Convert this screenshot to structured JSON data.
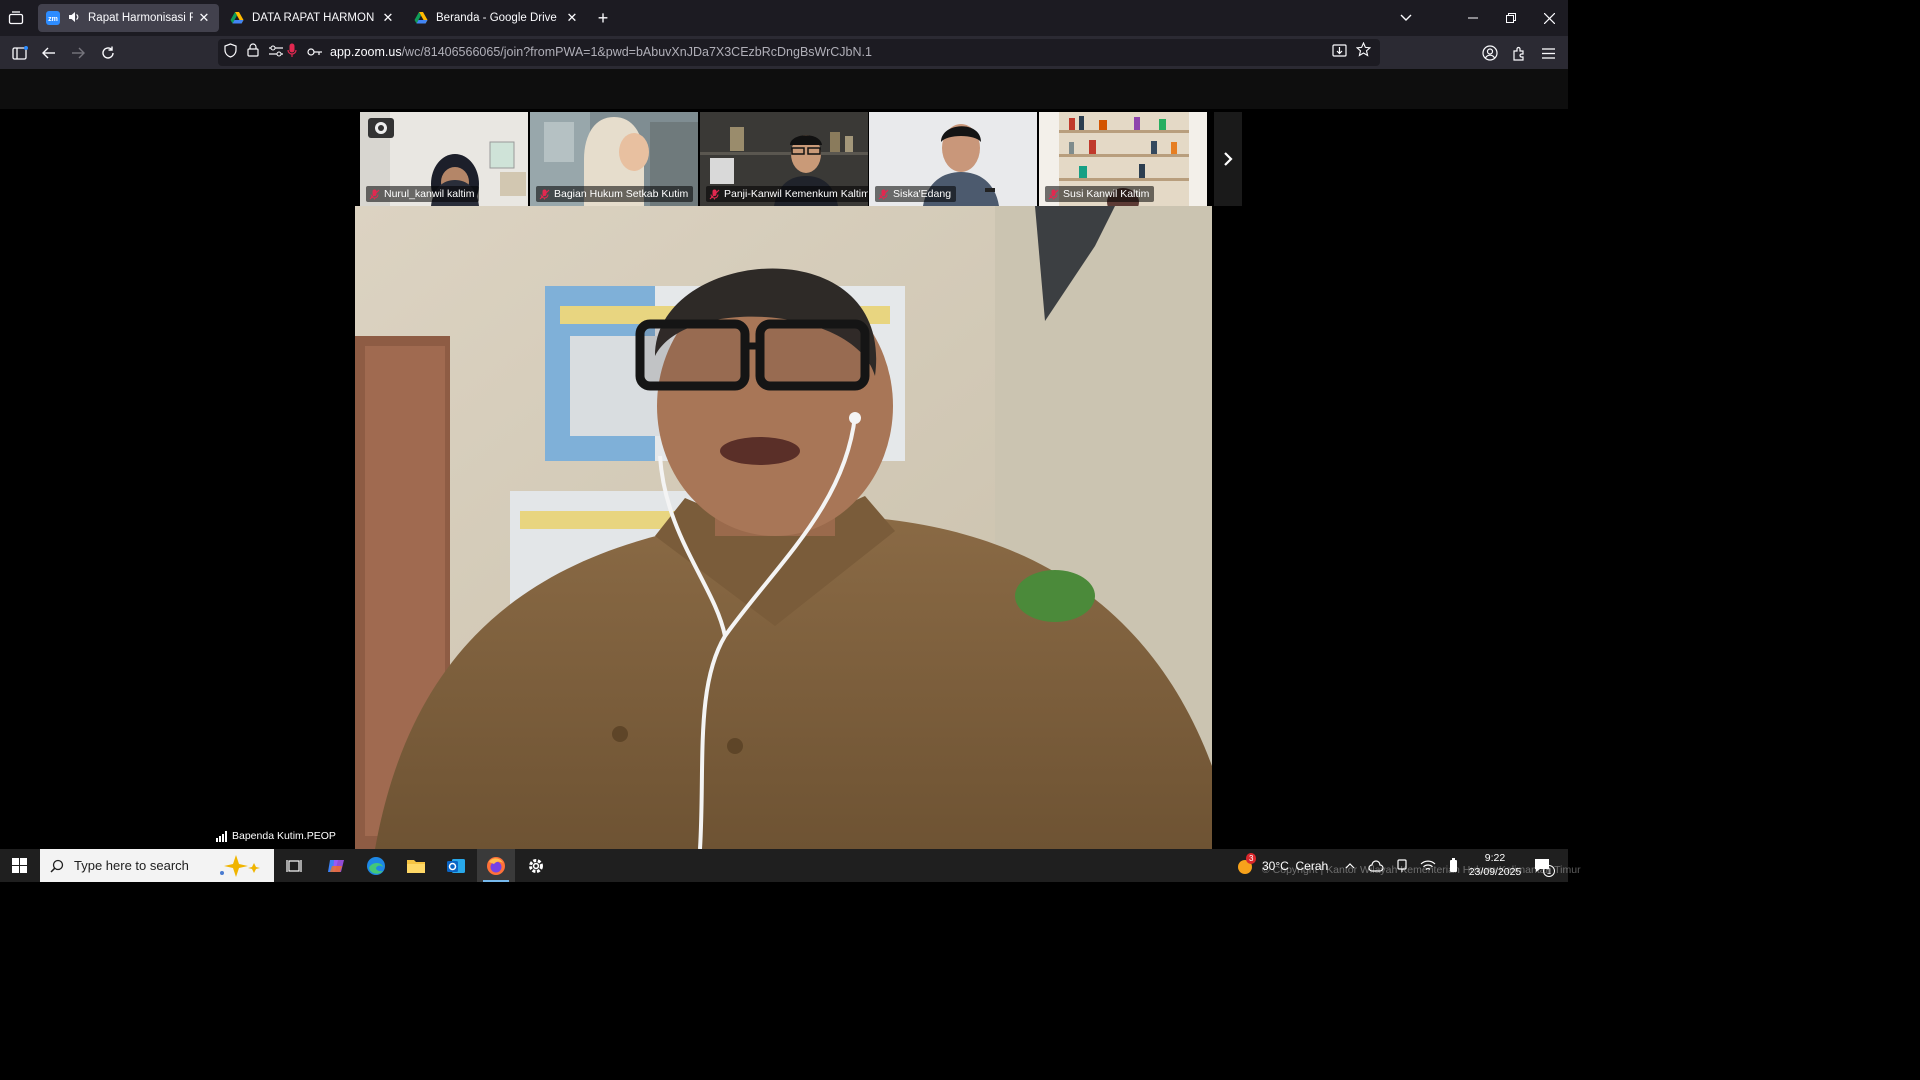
{
  "browser": {
    "tabs": [
      {
        "title": "Rapat Harmonisasi Raperbu",
        "favicon": "zoom-icon",
        "playing_audio": true,
        "active": true
      },
      {
        "title": "DATA RAPAT HARMON - Googl",
        "favicon": "google-drive-icon",
        "active": false
      },
      {
        "title": "Beranda - Google Drive",
        "favicon": "google-drive-icon",
        "active": false
      }
    ],
    "new_tab_label": "+",
    "url_domain": "app.zoom.us",
    "url_rest": "/wc/81406566065/join?fromPWA=1&pwd=bAbuvXnJDa7X3CEzbRcDngBsWrCJbN.1"
  },
  "meeting": {
    "participants": [
      {
        "name": "Nurul_kanwil kaltim",
        "muted": true
      },
      {
        "name": "Bagian Hukum Setkab Kutim",
        "muted": true
      },
      {
        "name": "Panji-Kanwil Kemenkum Kaltim",
        "muted": true
      },
      {
        "name": "Siska'Edang",
        "muted": true
      },
      {
        "name": "Susi Kanwil Kaltim",
        "muted": true
      }
    ],
    "active_speaker": "Bapenda Kutim.PEOP"
  },
  "taskbar": {
    "search_placeholder": "Type here to search",
    "weather": "30°C  Cerah",
    "weather_badge": "3",
    "time": "9:22",
    "date": "23/09/2025",
    "notification_count": "1",
    "watermark": "© Copyright | Kantor Wilayah Kementerian Hukum Kalimantan Timur"
  },
  "colors": {
    "tab_strip": "#1c1b22",
    "nav_bar": "#2b2a33",
    "active_tab": "#42414d",
    "mic_muted": "#e22850",
    "zoom_blue": "#2d8cff",
    "taskbar": "#1f1f1f"
  }
}
